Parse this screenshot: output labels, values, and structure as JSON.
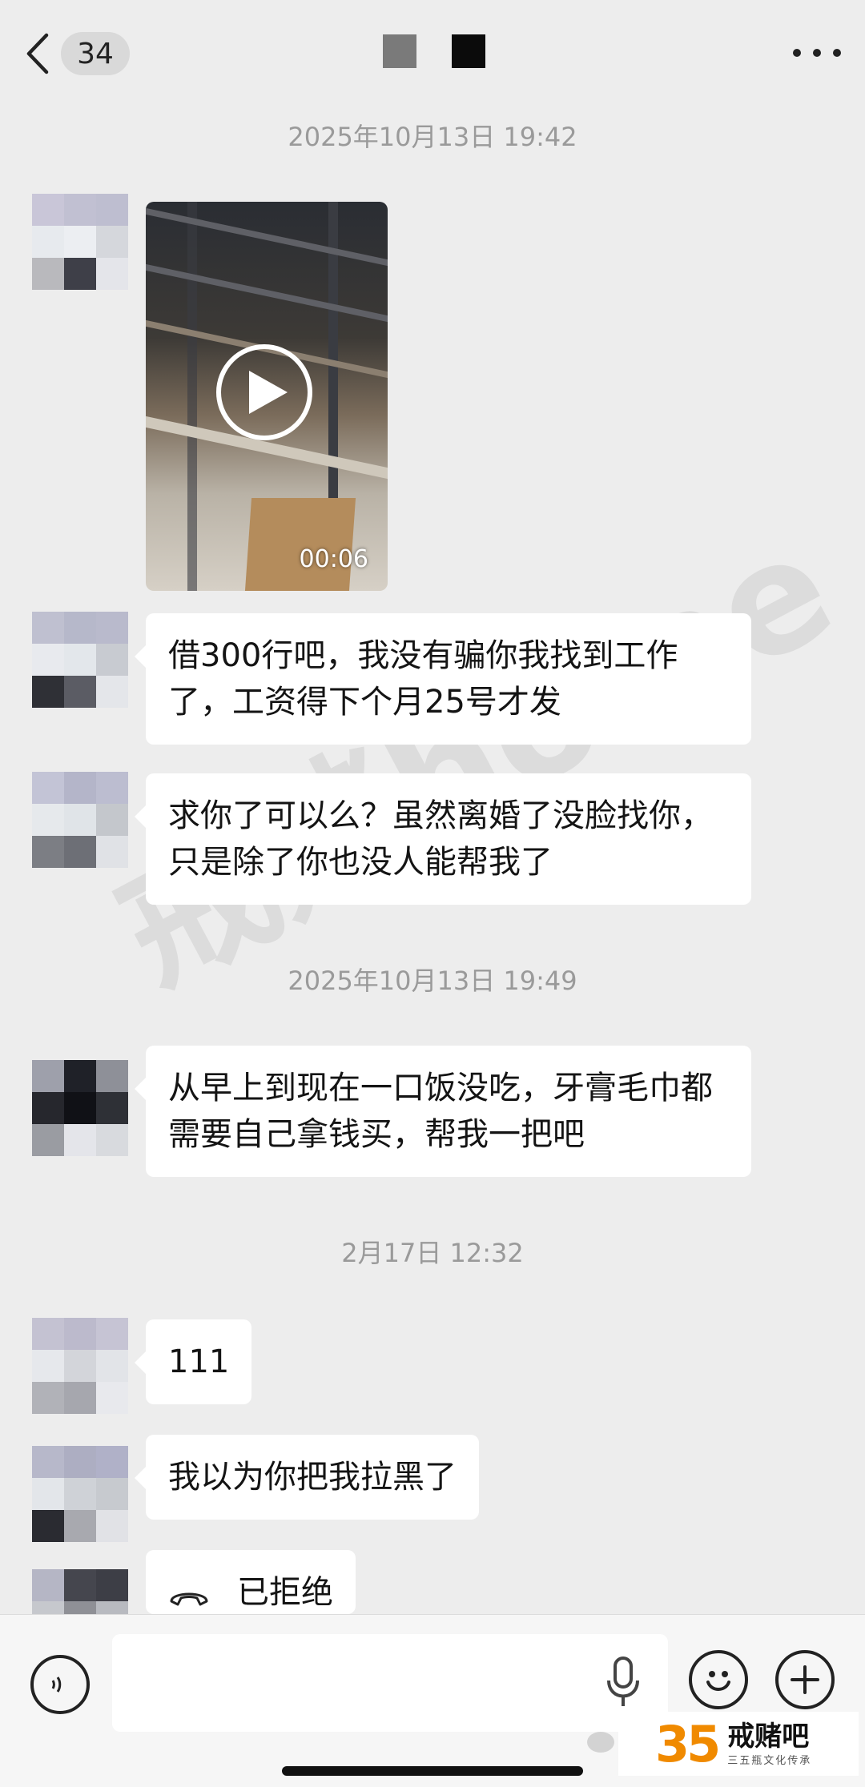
{
  "header": {
    "unread_count": "34",
    "icons": {
      "back": "chevron-left-icon",
      "more": "more-dots-icon"
    }
  },
  "timestamps": [
    "2025年10月13日 19:42",
    "2025年10月13日 19:49",
    "2月17日 12:32"
  ],
  "video": {
    "duration": "00:06",
    "icon": "play-icon"
  },
  "messages": [
    {
      "text": "借300行吧，我没有骗你我找到工作了，工资得下个月25号才发"
    },
    {
      "text": "求你了可以么？虽然离婚了没脸找你，只是除了你也没人能帮我了"
    },
    {
      "text": "从早上到现在一口饭没吃，牙膏毛巾都需要自己拿钱买，帮我一把吧"
    },
    {
      "text": "111"
    },
    {
      "text": "我以为你把我拉黑了"
    }
  ],
  "call": {
    "label": "已拒绝",
    "icon": "phone-hangup-icon"
  },
  "watermark": "戒赌home",
  "input": {
    "value": "",
    "icons": [
      "voice-icon",
      "mic-icon",
      "emoji-icon",
      "plus-icon"
    ]
  },
  "logo": {
    "number": "35",
    "name": "戒赌吧",
    "tagline": "三五瓶文化传承"
  },
  "colors": {
    "background": "#ededed",
    "bubble": "#ffffff",
    "timestamp": "#9a9a9a",
    "logo_orange": "#f08a00",
    "logo_blue": "#1a73e8"
  }
}
